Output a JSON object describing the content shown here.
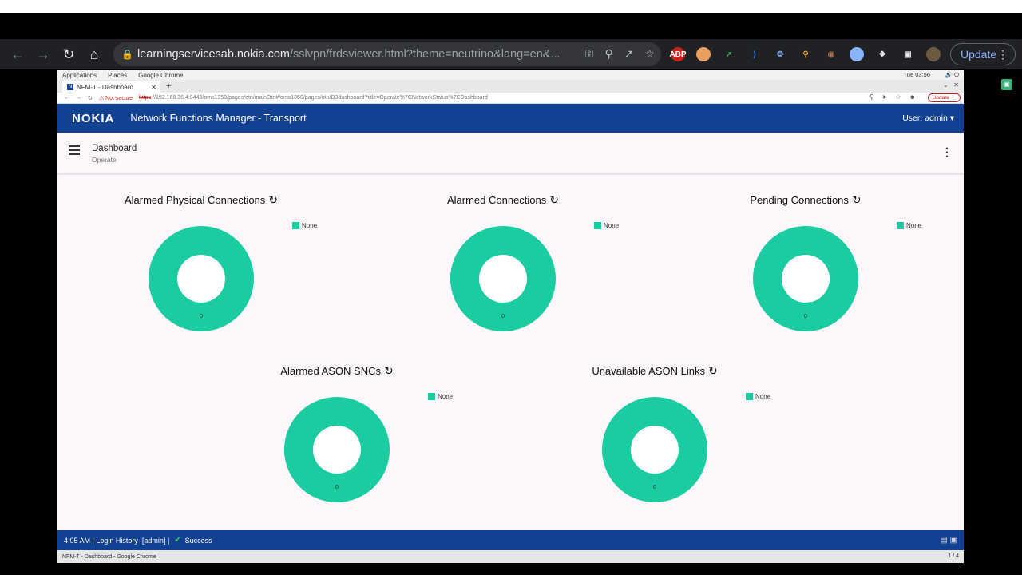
{
  "outer_browser": {
    "url_host": "learningservicesab.nokia.com",
    "url_rest": "/sslvpn/frdsviewer.html?theme=neutrino&lang=en&...",
    "update_label": "Update",
    "extensions": [
      "ABP"
    ]
  },
  "vm": {
    "menubar": {
      "items": [
        "Applications",
        "Places",
        "Google Chrome"
      ],
      "clock": "Tue 03:56"
    },
    "tab": {
      "title": "NFM-T - Dashboard",
      "favicon": "N"
    },
    "address": {
      "warning": "Not secure",
      "https": "https",
      "rest": "://192.168.36.4:8443/oms1350/pages/otn/mainOtn#/oms1350/pages/otn/D3dashboard?title=Operate%7CNetworkStatus%7CDashboard",
      "update_label": "Update"
    },
    "taskbar": {
      "label": "NFM-T - Dashboard - Google Chrome",
      "page": "1 / 4"
    }
  },
  "app": {
    "logo": "NOKIA",
    "title": "Network Functions Manager - Transport",
    "user_label": "User:  admin",
    "page_title": "Dashboard",
    "breadcrumb": "Operate"
  },
  "widgets": [
    {
      "title": "Alarmed Physical Connections",
      "legend": "None",
      "value": "0"
    },
    {
      "title": "Alarmed Connections",
      "legend": "None",
      "value": "0"
    },
    {
      "title": "Pending Connections",
      "legend": "None",
      "value": "0"
    },
    {
      "title": "Alarmed ASON SNCs",
      "legend": "None",
      "value": "0"
    },
    {
      "title": "Unavailable ASON Links",
      "legend": "None",
      "value": "0"
    }
  ],
  "status": {
    "time": "4:05 AM",
    "login_history": "Login History",
    "user": "[admin]",
    "result": "Success"
  },
  "colors": {
    "nokia_blue": "#124191",
    "donut": "#1ccca1"
  }
}
